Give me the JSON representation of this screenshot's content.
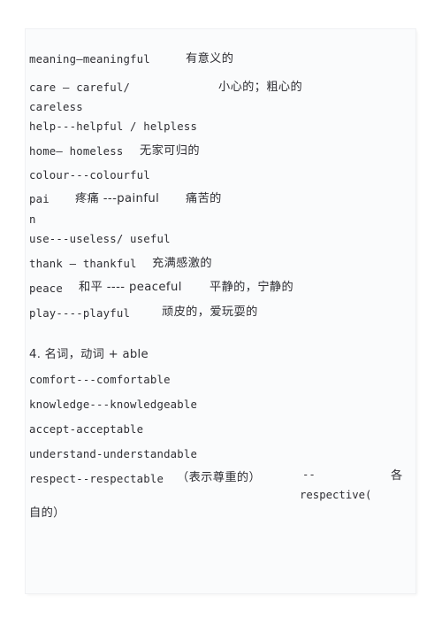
{
  "document": {
    "page_background": "#fafbfc",
    "text_color": "#2e2e33",
    "sections": [
      {
        "id": "ful-less-suffix-list",
        "entries": [
          {
            "english": "meaning—meaningful",
            "chinese": "有意义的"
          },
          {
            "english": "care — careful/",
            "chinese": "小心的；粗心的",
            "continuation": "careless"
          },
          {
            "english": "help---helpful / helpless",
            "chinese": ""
          },
          {
            "english": "home— homeless",
            "chinese": "无家可归的"
          },
          {
            "english": "colour---colourful",
            "chinese": ""
          },
          {
            "english": "pai",
            "middle": "疼痛 ---painful",
            "chinese": "痛苦的",
            "continuation": "n"
          },
          {
            "english": "use---useless/ useful",
            "chinese": ""
          },
          {
            "english": "thank — thankful",
            "chinese": "充满感激的"
          },
          {
            "english": "peace",
            "middle": "和平 ---- peaceful",
            "chinese": "平静的，宁静的"
          },
          {
            "english": "play----playful",
            "chinese": "顽皮的，爱玩耍的"
          }
        ]
      },
      {
        "id": "able-suffix-list",
        "heading": "4. 名词，动词 + able",
        "entries": [
          {
            "english": "comfort---comfortable",
            "chinese": ""
          },
          {
            "english": "knowledge---knowledgeable",
            "chinese": ""
          },
          {
            "english": "accept-acceptable",
            "chinese": ""
          },
          {
            "english": "understand-understandable",
            "chinese": ""
          },
          {
            "english": "respect--respectable",
            "chinese": "（表示尊重的）",
            "dash": "--",
            "tail_cn": "各",
            "tail_en": "respective(",
            "continuation": "自的）"
          }
        ]
      }
    ]
  },
  "lines": {
    "l01_en": "meaning—meaningful",
    "l01_cn": "有意义的",
    "l02_en": "care — careful/",
    "l02_cn": "小心的；粗心的",
    "l03_en": "careless",
    "l04_en": "help---helpful / helpless",
    "l05_en": "home— homeless",
    "l05_cn": "无家可归的",
    "l06_en": "colour---colourful",
    "l07_en": "pai",
    "l07_mid": "疼痛 ---painful",
    "l07_cn": "痛苦的",
    "l08_en": "n",
    "l09_en": "use---useless/ useful",
    "l10_en": "thank — thankful",
    "l10_cn": "充满感激的",
    "l11_en": "peace",
    "l11_mid": "和平 ---- peaceful",
    "l11_cn": "平静的，宁静的",
    "l12_en": "play----playful",
    "l12_cn": "顽皮的，爱玩耍的",
    "l13_heading": "4. 名词，动词 + able",
    "l14_en": "comfort---comfortable",
    "l15_en": "knowledge---knowledgeable",
    "l16_en": "accept-acceptable",
    "l17_en": "understand-understandable",
    "l18_en": "respect--respectable",
    "l18_cn": "（表示尊重的）",
    "l18_dash": "--",
    "l18_tail_cn": "各",
    "l19_en": "respective(",
    "l20_cn": "自的）"
  }
}
